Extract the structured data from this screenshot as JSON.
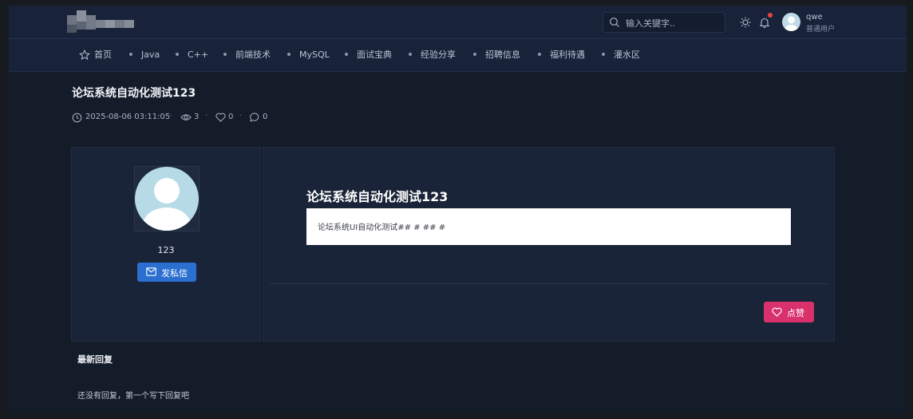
{
  "header": {
    "logo": "pixelated-logo",
    "search": {
      "placeholder": "输入关键字.."
    },
    "theme_icon": "sun-icon",
    "notification_icon": "bell-icon",
    "notification_dot_color": "#e8443d",
    "user": {
      "name": "qwe",
      "role": "普通用户"
    }
  },
  "nav": {
    "home": {
      "icon": "star-icon",
      "label": "首页"
    },
    "items": [
      {
        "label": "Java"
      },
      {
        "label": "C++"
      },
      {
        "label": "前端技术"
      },
      {
        "label": "MySQL"
      },
      {
        "label": "面试宝典"
      },
      {
        "label": "经验分享"
      },
      {
        "label": "招聘信息"
      },
      {
        "label": "福利待遇"
      },
      {
        "label": "灌水区"
      }
    ]
  },
  "post": {
    "title": "论坛系统自动化测试123",
    "meta": {
      "date": "2025-08-06 03:11:05",
      "views": "3",
      "likes": "0",
      "comments": "0",
      "separator": "·"
    },
    "author": {
      "name": "123",
      "message_button": "发私信"
    },
    "content_title": "论坛系统自动化测试123",
    "content_body": "论坛系统UI自动化测试## # ## #",
    "like_button": "点赞"
  },
  "replies": {
    "title": "最新回复",
    "empty_text": "还没有回复，第一个写下回复吧"
  },
  "colors": {
    "page_bg": "#141b29",
    "header_bg": "#18233a",
    "panel_bg": "#1a2438",
    "primary_button": "#2b6fd1",
    "like_button": "#d8316c"
  }
}
